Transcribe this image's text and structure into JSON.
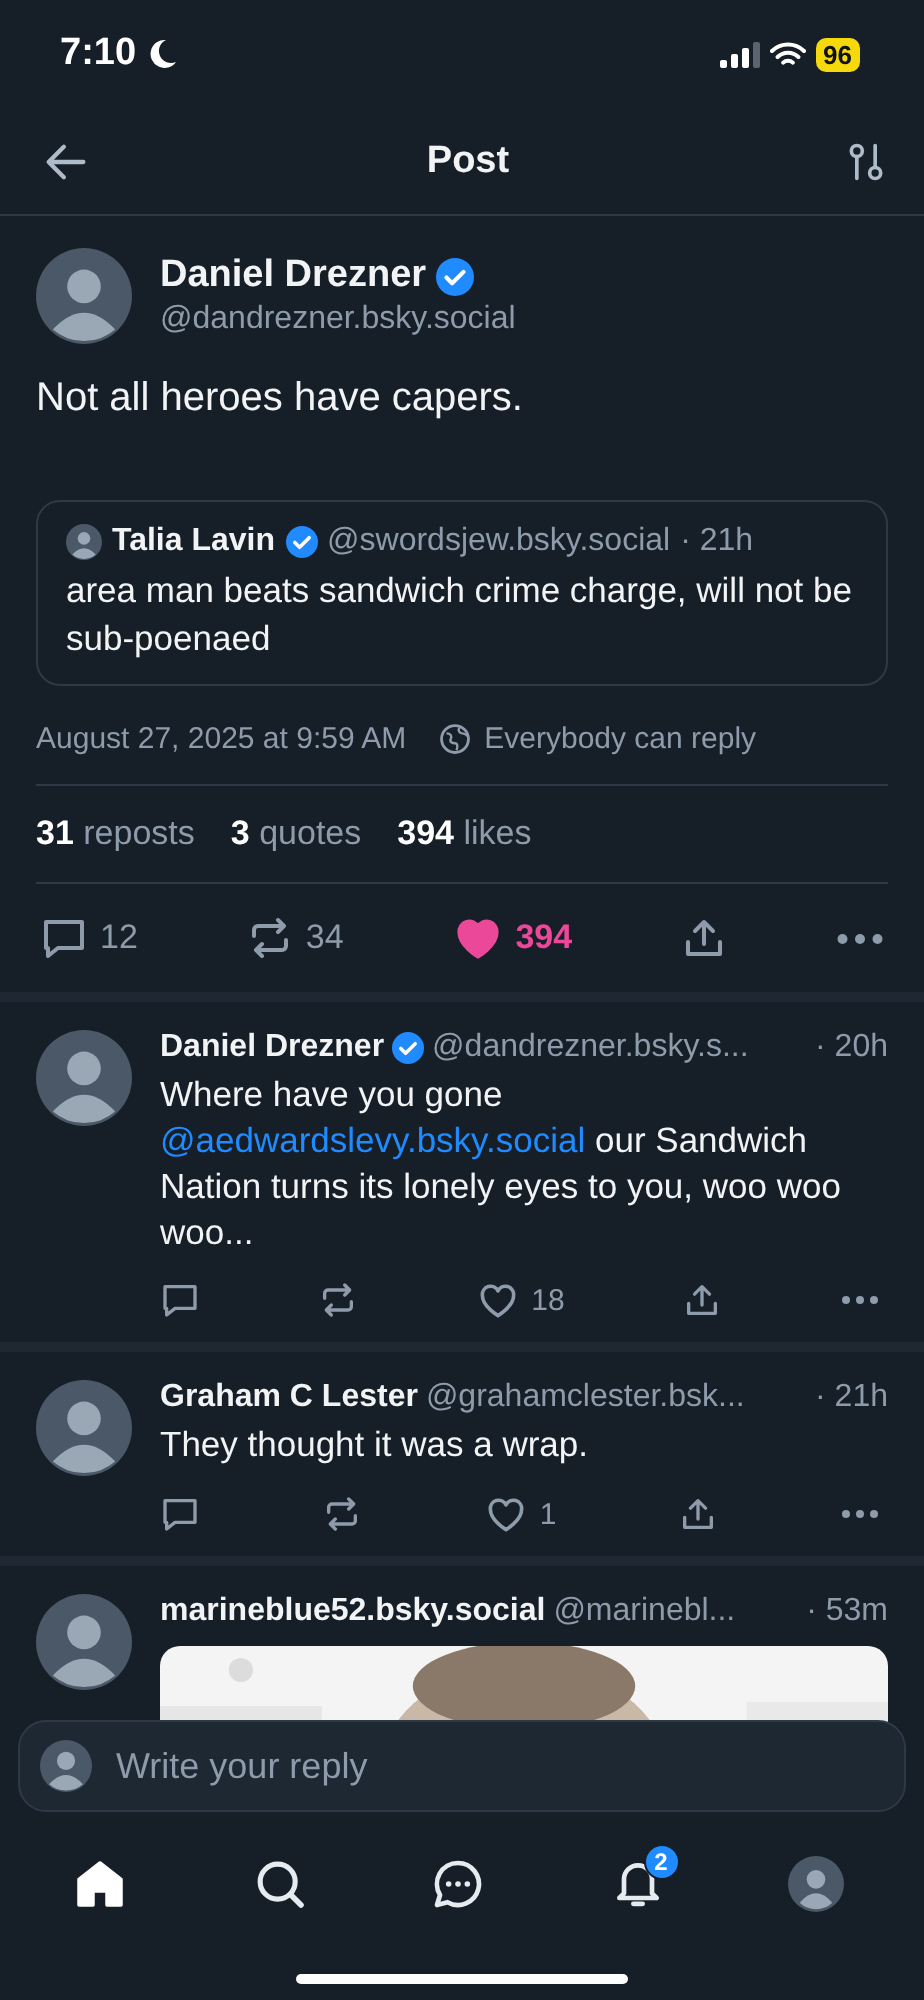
{
  "status_bar": {
    "time": "7:10",
    "battery": "96"
  },
  "header": {
    "title": "Post"
  },
  "post": {
    "author": {
      "name": "Daniel Drezner",
      "verified": true,
      "handle": "@dandrezner.bsky.social"
    },
    "text": "Not all heroes have capers.",
    "quote": {
      "name": "Talia Lavin",
      "verified": true,
      "handle": "@swordsjew.bsky.social",
      "time": "· 21h",
      "text": "area man beats sandwich crime charge, will not be sub-poenaed"
    },
    "timestamp": "August 27, 2025 at 9:59 AM",
    "reply_setting": "Everybody can reply",
    "stats": [
      {
        "count": "31",
        "label": "reposts"
      },
      {
        "count": "3",
        "label": "quotes"
      },
      {
        "count": "394",
        "label": "likes"
      }
    ],
    "actions": {
      "replies": "12",
      "reposts": "34",
      "likes": "394",
      "liked": true
    }
  },
  "replies": [
    {
      "name": "Daniel Drezner",
      "verified": true,
      "handle": "@dandrezner.bsky.s...",
      "time": "· 20h",
      "text": [
        {
          "kind": "plain",
          "text": "Where have you gone "
        },
        {
          "kind": "mention",
          "text": "@aedwardslevy.bsky.social"
        },
        {
          "kind": "plain",
          "text": " our Sandwich Nation turns its lonely eyes to you, woo woo woo..."
        }
      ],
      "actions": {
        "likes": "18",
        "liked": false
      }
    },
    {
      "name": "Graham C Lester",
      "verified": false,
      "handle": "@grahamclester.bsk...",
      "time": "· 21h",
      "text": [
        {
          "kind": "plain",
          "text": "They thought it was a wrap."
        }
      ],
      "actions": {
        "likes": "1",
        "liked": false
      }
    },
    {
      "name": "marineblue52.bsky.social",
      "verified": false,
      "handle": "@marinebl...",
      "time": "· 53m"
    }
  ],
  "composer": {
    "placeholder": "Write your reply"
  },
  "tab_bar": [
    {
      "kind": "home",
      "selected": true
    },
    {
      "kind": "search",
      "selected": false
    },
    {
      "kind": "chat",
      "selected": false
    },
    {
      "kind": "notifications",
      "selected": false,
      "badge": "2"
    },
    {
      "kind": "profile",
      "selected": false
    }
  ]
}
